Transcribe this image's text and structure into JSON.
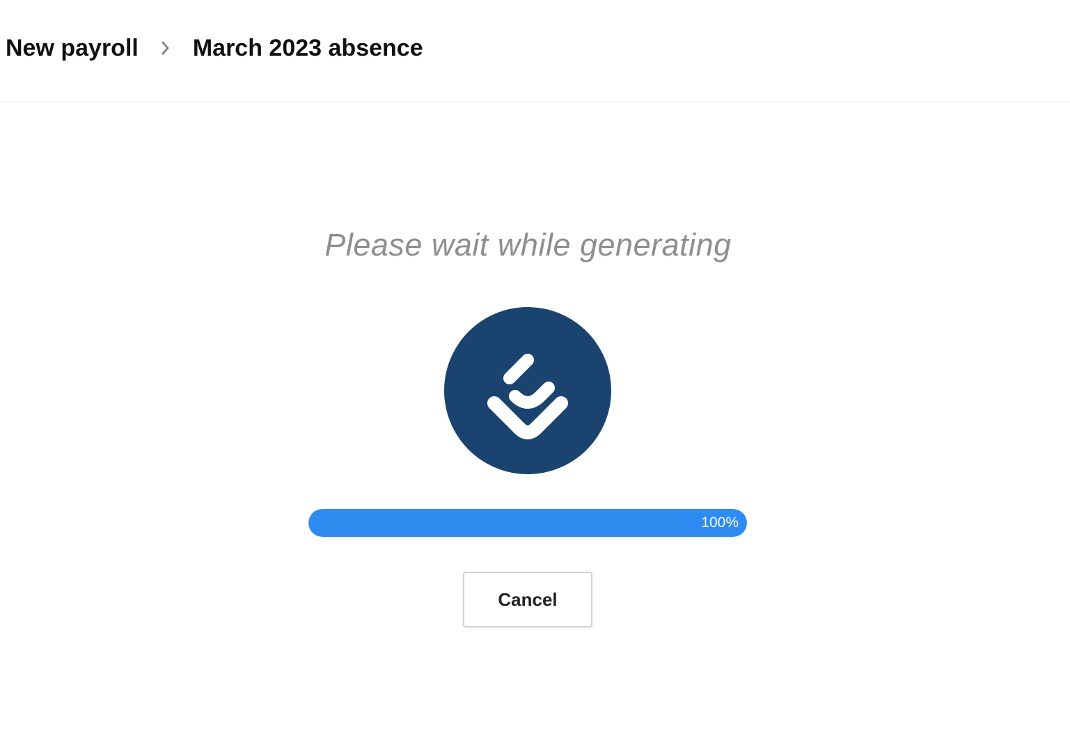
{
  "breadcrumb": {
    "items": [
      {
        "label": "New payroll"
      },
      {
        "label": "March 2023 absence"
      }
    ],
    "separator_icon": "chevron-right-icon"
  },
  "generation": {
    "message": "Please wait while generating",
    "logo_icon": "brand-logo-icon",
    "progress_percent": 100,
    "progress_label": "100%"
  },
  "actions": {
    "cancel_label": "Cancel"
  },
  "colors": {
    "logo_background": "#1a446f",
    "progress_fill": "#2e8bef",
    "message_text": "#8e8e8e"
  }
}
